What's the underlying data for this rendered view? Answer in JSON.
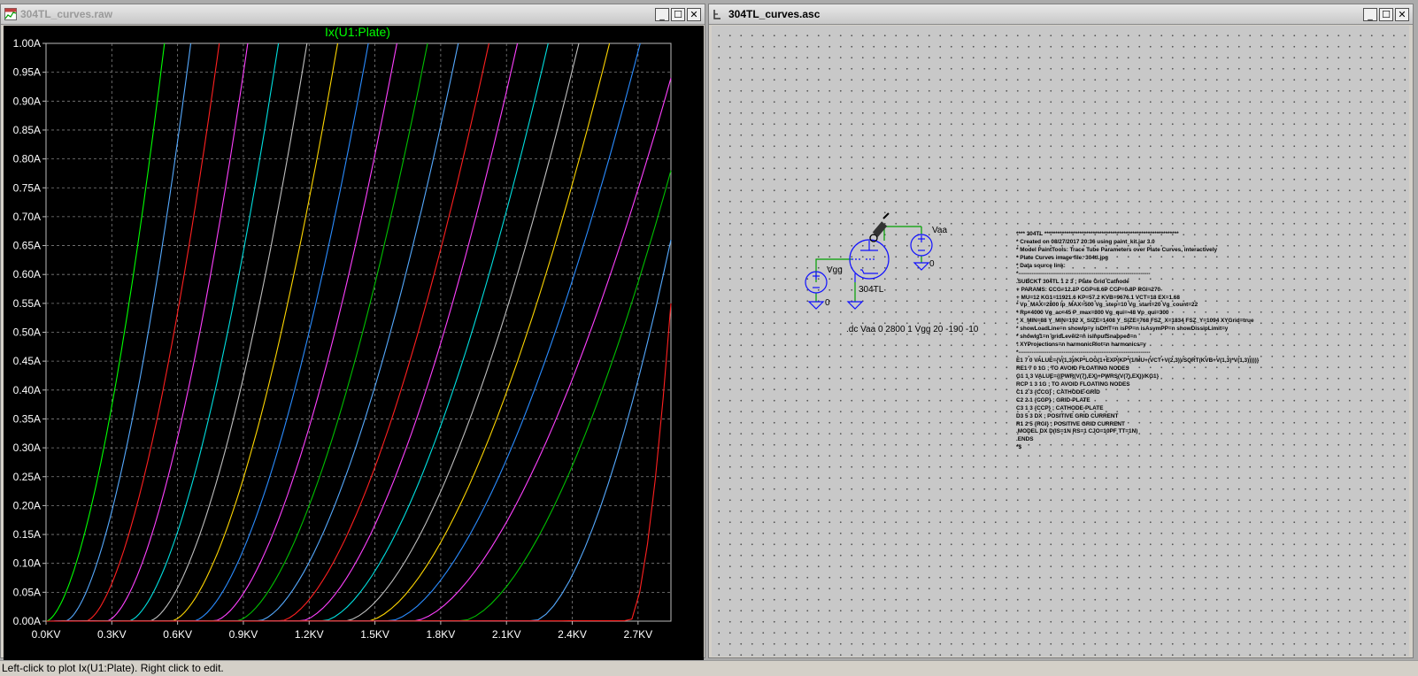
{
  "left_window": {
    "title": "304TL_curves.raw",
    "buttons": {
      "minimize": "_",
      "maximize": "☐",
      "close": "✕"
    }
  },
  "right_window": {
    "title": "304TL_curves.asc",
    "buttons": {
      "minimize": "_",
      "maximize": "☐",
      "close": "✕"
    }
  },
  "colors": {
    "plot_bg": "#000000",
    "trace_title": "#00ff00",
    "grid": "#7f7f7f",
    "wire": "#00a000",
    "component": "#1010ff"
  },
  "plot": {
    "trace_label": "Ix(U1:Plate)",
    "y_ticks": [
      "1.00A",
      "0.95A",
      "0.90A",
      "0.85A",
      "0.80A",
      "0.75A",
      "0.70A",
      "0.65A",
      "0.60A",
      "0.55A",
      "0.50A",
      "0.45A",
      "0.40A",
      "0.35A",
      "0.30A",
      "0.25A",
      "0.20A",
      "0.15A",
      "0.10A",
      "0.05A",
      "0.00A"
    ],
    "x_ticks": [
      "0.0KV",
      "0.3KV",
      "0.6KV",
      "0.9KV",
      "1.2KV",
      "1.5KV",
      "1.8KV",
      "2.1KV",
      "2.4KV",
      "2.7KV"
    ]
  },
  "chart_data": {
    "type": "line",
    "title": "Ix(U1:Plate)",
    "xlabel": "",
    "ylabel": "",
    "xlim": [
      0,
      2.85
    ],
    "ylim": [
      0,
      1.0
    ],
    "x_unit": "KV",
    "y_unit": "A",
    "grid": true,
    "legend": "none",
    "series_colors": [
      "#00ff00",
      "#55aaff",
      "#ff2020",
      "#ff40ff",
      "#00e0e0",
      "#c0c0c0",
      "#ffd700",
      "#2a8cff",
      "#ff40ff",
      "#00c000",
      "#55aaff",
      "#ff2020",
      "#ff40ff",
      "#00e0e0",
      "#c0c0c0",
      "#ffd700",
      "#2a8cff",
      "#ff40ff",
      "#00c000",
      "#55aaff",
      "#ff2020",
      "#ffa500",
      "#ff00ff"
    ],
    "series": [
      {
        "values_at_x": [
          0.0,
          0.3,
          0.6,
          0.9,
          1.2,
          1.5,
          1.8,
          2.1,
          2.4,
          2.7
        ],
        "y": [
          0,
          0.44,
          1.0
        ]
      },
      {
        "y_at_1A_kv": 0.87
      }
    ],
    "trace_end_kv_at_1A": [
      0.54,
      0.66,
      0.79,
      0.92,
      1.06,
      1.19,
      1.33,
      1.47,
      1.6,
      1.74,
      1.88,
      2.02,
      2.15,
      2.29,
      2.43,
      2.57,
      2.71
    ],
    "edge_traces_y_at_xmax": [
      0.94,
      0.78,
      0.66,
      0.55
    ]
  },
  "schematic": {
    "vaa_label": "Vaa",
    "vaa_ground": "0",
    "vgg_label": "Vgg",
    "vgg_ground": "0",
    "tube_label": "304TL",
    "dc_directive": ".dc Vaa 0 2800 1 Vgg 20 -190 -10",
    "netlist": [
      "**** 304TL *************************************************************",
      "* Created on 08/27/2017 20:36 using paint_kit.jar 3.0",
      "* Model PaintTools: Trace Tube Parameters over Plate Curves, interactively",
      "* Plate Curves image file: 304tl.jpg",
      "* Data source link: ",
      "*----------------------------------------------------------------------",
      ".SUBCKT 304TL 1 2 3 ; Plate Grid Cathode",
      "+ PARAMS: CCG=12.1P CGP=8.6P CCP=0.8P RGI=270",
      "+ MU=12 KG1=11921.6 KP=57.2 KVB=9676.1 VCT=18 EX=1.68",
      "* Vp_MAX=2800 Ip_MAX=500 Vg_step=10 Vg_start=20 Vg_count=22",
      "* Rp=4000 Vg_ac=45 P_max=300 Vg_qui=-48 Vp_qui=300",
      "* X_MIN=88 Y_MIN=192 X_SIZE=1408 Y_SIZE=768 FSZ_X=1834 FSZ_Y=1094 XYGrid=true",
      "* showLoadLine=n showIp=y isDHT=n isPP=n isAsymPP=n showDissipLimit=y",
      "* showIg1=n gridLevel2=n isInputSnapped=n",
      "* XYProjections=n harmonicPlot=n harmonics=y",
      "*----------------------------------------------------------------------",
      "E1 7 0 VALUE={V(1,3)/KP*LOG(1+EXP(KP*(1/MU+(VCT+V(2,3))/SQRT(KVB+V(1,3)*V(1,3)))))}",
      "RE1 7 0 1G ; TO AVOID FLOATING NODES",
      "G1 1 3 VALUE={(PWR(V(7),EX)+PWRS(V(7),EX))/KG1}",
      "RCP 1 3 1G ; TO AVOID FLOATING NODES",
      "C1 2 3 {CCG} ; CATHODE-GRID",
      "C2 2 1 {CGP} ; GRID-PLATE",
      "C3 1 3 {CCP} ; CATHODE-PLATE",
      "D3 5 3 DX ; POSITIVE GRID CURRENT",
      "R1 2 5 {RGI} ; POSITIVE GRID CURRENT",
      ".MODEL DX D(IS=1N RS=1 CJO=10PF TT=1N)",
      ".ENDS",
      "*$"
    ]
  },
  "status": "Left-click to plot Ix(U1:Plate).  Right click to edit."
}
